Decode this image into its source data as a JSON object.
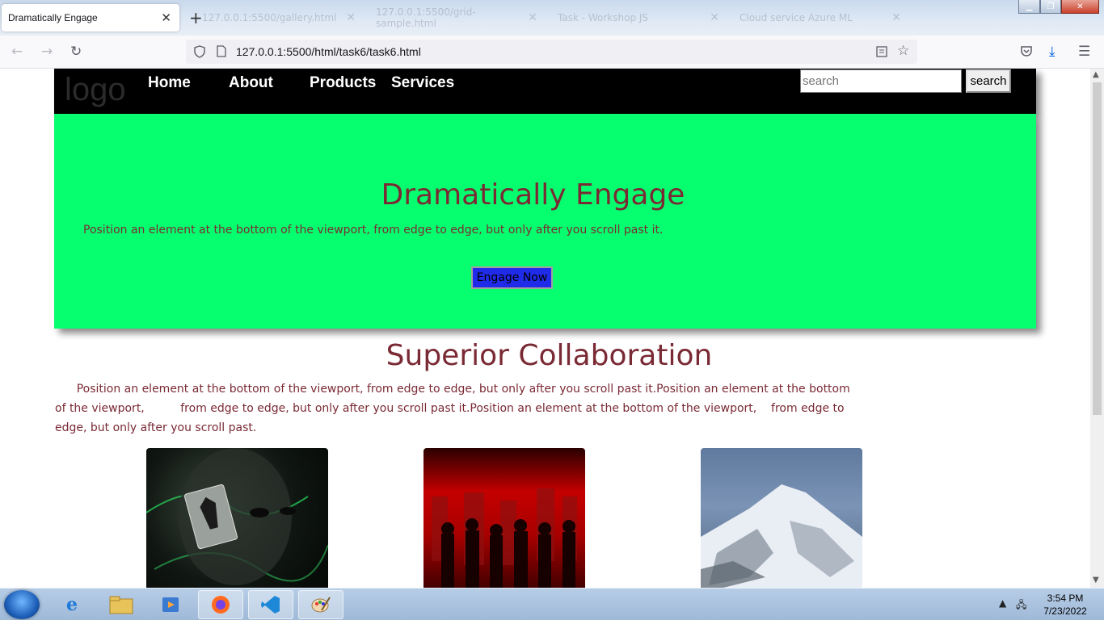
{
  "browser": {
    "active_tab_title": "Dramatically Engage",
    "background_tabs": [
      "127.0.0.1:5500/gallery.html",
      "127.0.0.1:5500/grid-sample.html",
      "Task - Workshop JS",
      "Cloud service Azure ML"
    ],
    "url": "127.0.0.1:5500/html/task6/task6.html"
  },
  "nav": {
    "logo": "logo",
    "links": [
      "Home",
      "About",
      "Products",
      "Services"
    ],
    "search_placeholder": "search",
    "search_button": "search"
  },
  "hero": {
    "title": "Dramatically Engage",
    "text": "Position an element at the bottom of the viewport, from edge to edge, but only after you scroll past it.",
    "button": "Engage Now",
    "background_color": "#06ff6e",
    "button_color": "#1f2be8"
  },
  "section": {
    "title": "Superior Collaboration",
    "lines": [
      "      Position an element at the bottom of the viewport, from edge to edge, but only after you scroll past it.Position an element at the bottom",
      "of the viewport,          from edge to edge, but only after you scroll past it.Position an element at the bottom of the viewport,    from edge to",
      "edge, but only after you scroll past."
    ],
    "text_color": "#7a2a34"
  },
  "cards": [
    {
      "image": "joker-batman-card-image"
    },
    {
      "image": "silhouette-crowd-red-image"
    },
    {
      "image": "snowy-mountain-image"
    }
  ],
  "taskbar": {
    "time": "3:54 PM",
    "date": "7/23/2022"
  }
}
